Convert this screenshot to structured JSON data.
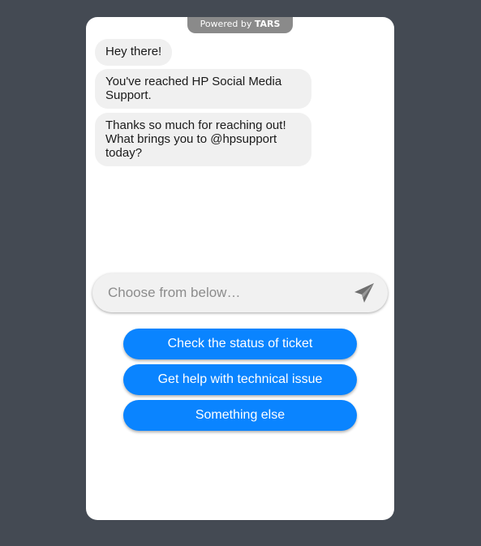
{
  "powered": {
    "prefix": "Powered by ",
    "brand": "TARS"
  },
  "messages": [
    {
      "text": "Hey there!"
    },
    {
      "text": "You've reached HP Social Media Support."
    },
    {
      "text": "Thanks so much for reaching out! What brings you to @hpsupport today?"
    }
  ],
  "input": {
    "placeholder": "Choose from below…",
    "send_icon": "paper-plane-icon"
  },
  "options": [
    {
      "label": "Check the status of ticket"
    },
    {
      "label": "Get help with technical issue"
    },
    {
      "label": "Something else"
    }
  ],
  "colors": {
    "background": "#444a53",
    "card": "#ffffff",
    "bubble": "#f0f0f0",
    "accent": "#0a84ff",
    "badge": "#8a8a8a"
  }
}
